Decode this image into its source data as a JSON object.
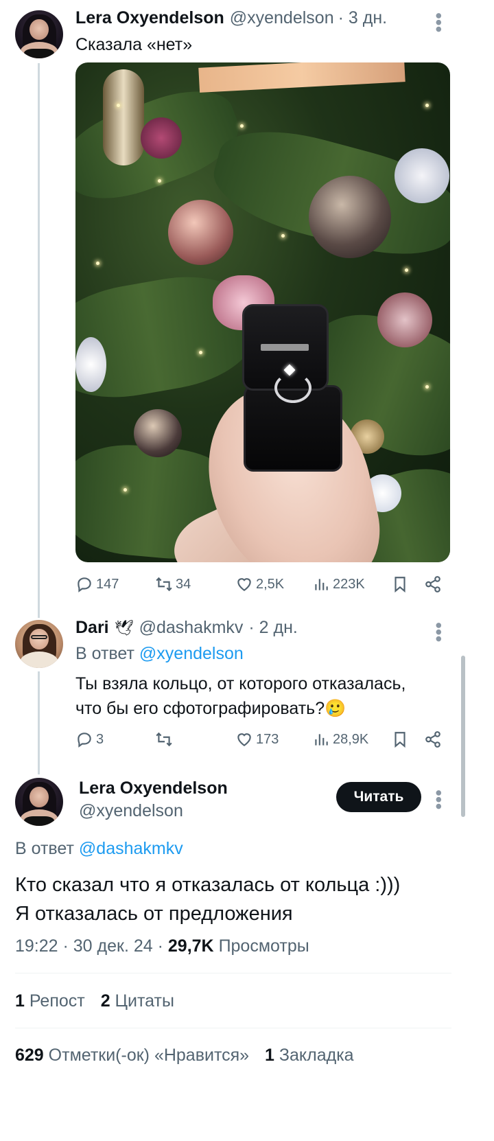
{
  "tweet1": {
    "name": "Lera Oxyendelson",
    "handle": "@xyendelson",
    "time": "· 3 дн.",
    "text": "Сказала «нет»",
    "stats": {
      "replies": "147",
      "reposts": "34",
      "likes": "2,5K",
      "views": "223K"
    }
  },
  "tweet2": {
    "name": "Dari",
    "emoji": "🕊",
    "handle": "@dashakmkv",
    "time": "· 2 дн.",
    "reply_prefix": "В ответ",
    "reply_to": "@xyendelson",
    "text_line1": "Ты взяла кольцо, от которого отказалась,",
    "text_line2": "что бы его сфотографировать?🥲",
    "stats": {
      "replies": "3",
      "reposts": "",
      "likes": "173",
      "views": "28,9K"
    }
  },
  "tweet3": {
    "name": "Lera Oxyendelson",
    "handle": "@xyendelson",
    "follow_label": "Читать",
    "reply_prefix": "В ответ",
    "reply_to": "@dashakmkv",
    "text_line1": "Кто сказал что я отказалась от кольца :)))",
    "text_line2": "Я отказалась от предложения",
    "timestamp": "19:22 · 30 дек. 24 ·",
    "views_count": "29,7K",
    "views_label": "Просмотры",
    "reposts_count": "1",
    "reposts_label": "Репост",
    "quotes_count": "2",
    "quotes_label": "Цитаты",
    "likes_count": "629",
    "likes_label": "Отметки(-ок) «Нравится»",
    "bookmarks_count": "1",
    "bookmarks_label": "Закладка"
  },
  "icons": {
    "reply": "reply-icon",
    "repost": "repost-icon",
    "like": "heart-icon",
    "views": "views-icon",
    "bookmark": "bookmark-icon",
    "share": "share-icon",
    "more": "more-icon"
  },
  "colors": {
    "link": "#1d9bf0",
    "muted": "#536471",
    "text": "#0f1419"
  }
}
